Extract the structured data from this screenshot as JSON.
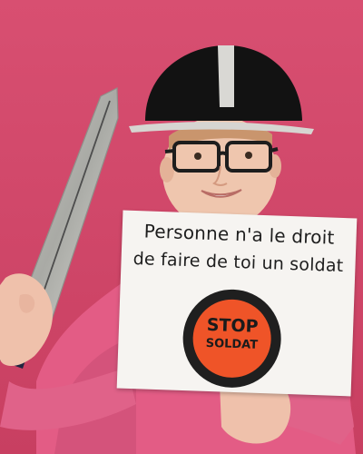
{
  "photo": {
    "sign": {
      "line1": "Personne n'a le droit",
      "line2": "de faire de toi un soldat",
      "stop_word": "STOP",
      "stop_word2": "SOLDAT"
    },
    "colors": {
      "wall": "#d24a6a",
      "sweater": "#e35c85",
      "helmet": "#111111",
      "stop_circle": "#ef5428"
    }
  }
}
